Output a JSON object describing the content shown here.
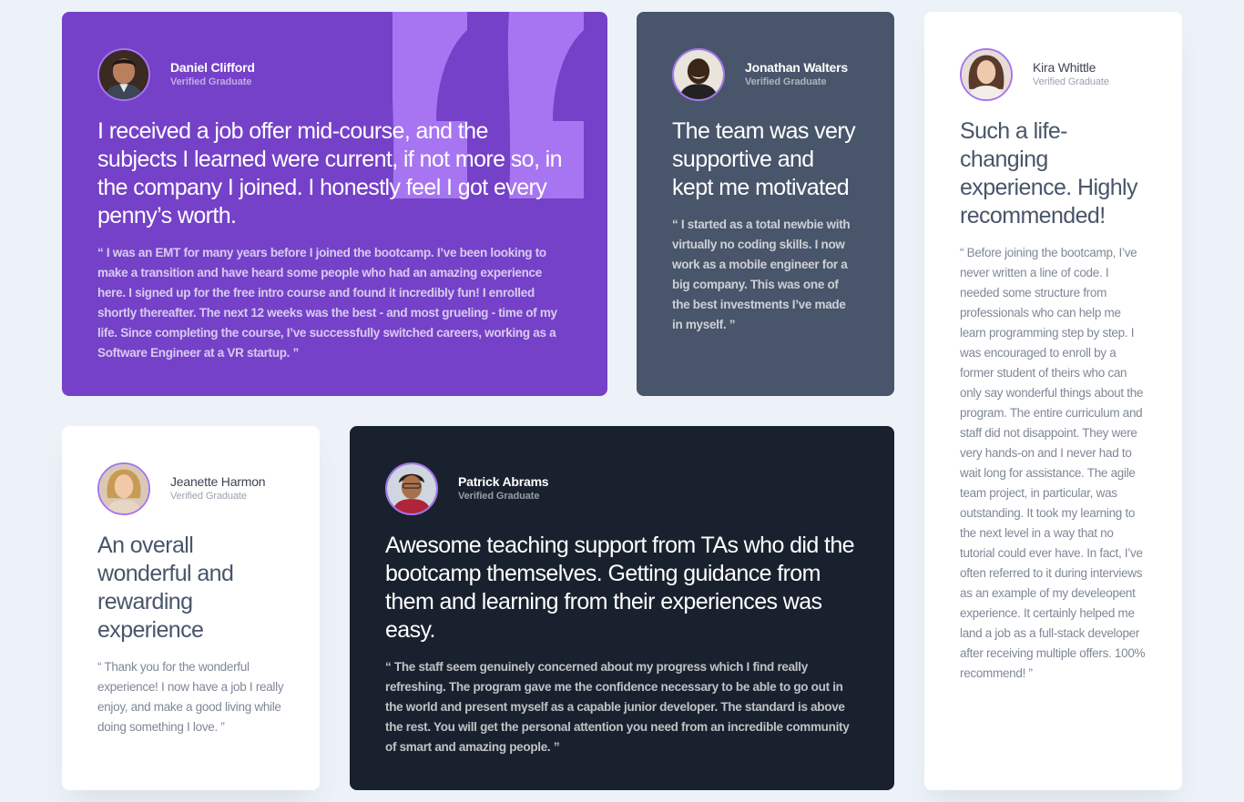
{
  "colors": {
    "page_bg": "#ecf2f8",
    "purple": "#7541c8",
    "slate": "#48556a",
    "white": "#ffffff",
    "dark": "#19212e",
    "avatar_ring": "#a775f1"
  },
  "testimonials": [
    {
      "name": "Daniel Clifford",
      "role": "Verified Graduate",
      "headline": "I received a job offer mid-course, and the subjects I learned were current, if not more so, in the company I joined. I honestly feel I got every penny’s worth.",
      "body": "“ I was an EMT for many years before I joined the bootcamp. I’ve been looking to make a transition and have heard some people who had an amazing experience here. I signed up for the free intro course and found it incredibly fun! I enrolled shortly thereafter. The next 12 weeks was the best - and most grueling - time of my life. Since completing the course, I’ve successfully switched careers, working as a Software Engineer at a VR startup. ”",
      "avatar_icon": "avatar-daniel-icon"
    },
    {
      "name": "Jonathan Walters",
      "role": "Verified Graduate",
      "headline": "The team was very supportive and kept me motivated",
      "body": "“ I started as a total newbie with virtually no coding skills. I now work as a mobile engineer for a big company. This was one of the best investments I’ve made in myself. ”",
      "avatar_icon": "avatar-jonathan-icon"
    },
    {
      "name": "Jeanette Harmon",
      "role": "Verified Graduate",
      "headline": "An overall wonderful and rewarding experience",
      "body": "“ Thank you for the wonderful experience! I now have a job I really enjoy, and make a good living while doing something I love. ”",
      "avatar_icon": "avatar-jeanette-icon"
    },
    {
      "name": "Patrick Abrams",
      "role": "Verified Graduate",
      "headline": "Awesome teaching support from TAs who did the bootcamp themselves. Getting guidance from them and learning from their experiences was easy.",
      "body": "“ The staff seem genuinely concerned about my progress which I find really refreshing. The program gave me the confidence necessary to be able to go out in the world and present myself as a capable junior developer. The standard is above the rest. You will get the personal attention you need from an incredible community of smart and amazing people. ”",
      "avatar_icon": "avatar-patrick-icon"
    },
    {
      "name": "Kira Whittle",
      "role": "Verified Graduate",
      "headline": "Such a life-changing experience. Highly recommended!",
      "body": "“ Before joining the bootcamp, I’ve never written a line of code. I needed some structure from professionals who can help me learn programming step by step. I was encouraged to enroll by a former student of theirs who can only say wonderful things about the program. The entire curriculum and staff did not disappoint. They were very hands-on and I never had to wait long for assistance. The agile team project, in particular, was outstanding. It took my learning to the next level in a way that no tutorial could ever have. In fact, I’ve often referred to it during interviews as an example of my develeopent experience. It certainly helped me land a job as a full-stack developer after receiving multiple offers. 100% recommend! ”",
      "avatar_icon": "avatar-kira-icon"
    }
  ]
}
